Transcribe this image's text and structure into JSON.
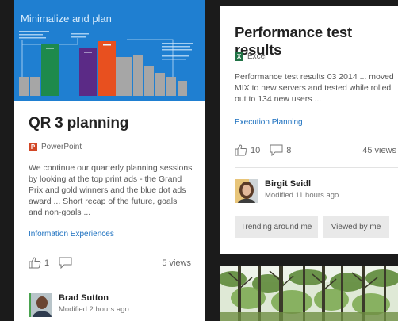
{
  "cards": {
    "left": {
      "thumbnail_title": "Minimalize and plan",
      "title": "QR 3 planning",
      "app": "PowerPoint",
      "description_lines": [
        "We continue our quarterly planning sessions",
        "by looking at the top print ads - the Grand",
        "Prix and gold winners and the blue dot ads",
        "award ... Short recap of the future, goals",
        "and non-goals ..."
      ],
      "tag": "Information Experiences",
      "likes": "1",
      "views": "5 views",
      "person": {
        "name": "Brad Sutton",
        "meta": "Modified 2 hours ago"
      }
    },
    "right": {
      "title": "Performance test results",
      "app": "Excel",
      "description_lines": [
        "Performance test results 03 2014 ... moved",
        "MIX to new servers and tested while rolled",
        "out to 134 new users ..."
      ],
      "tag": "Execution Planning",
      "likes": "10",
      "comments": "8",
      "views": "45 views",
      "person": {
        "name": "Birgit Seidl",
        "meta": "Modified 11 hours ago"
      },
      "chips": [
        "Trending around me",
        "Viewed by me"
      ]
    }
  },
  "colors": {
    "thumbnail_bg": "#1f7fd1",
    "powerpoint": "#d24726",
    "excel": "#207245",
    "link": "#1a6fbf",
    "bar_green": "#1e8a4c",
    "bar_purple": "#5b2a86",
    "bar_orange": "#e8501f",
    "bar_gray": "#a6a6a6"
  }
}
